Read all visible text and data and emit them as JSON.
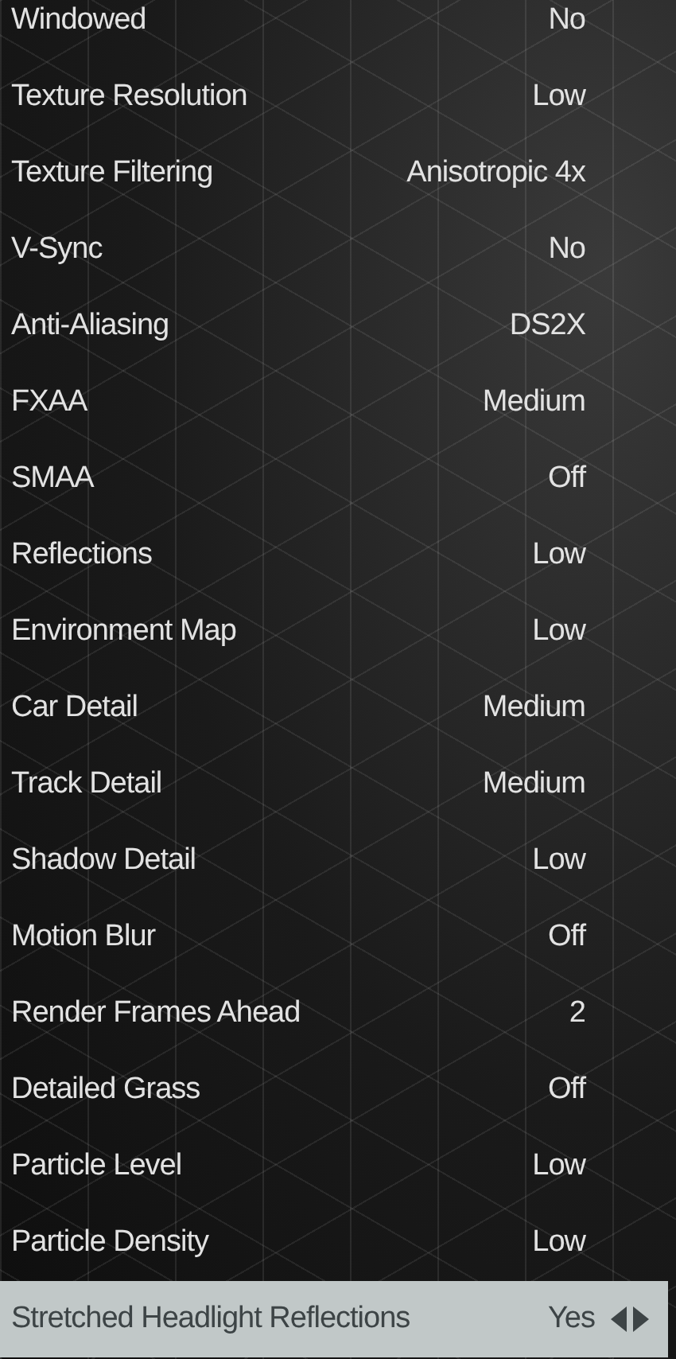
{
  "settings": [
    {
      "label": "Windowed",
      "value": "No",
      "selected": false
    },
    {
      "label": "Texture Resolution",
      "value": "Low",
      "selected": false
    },
    {
      "label": "Texture Filtering",
      "value": "Anisotropic 4x",
      "selected": false
    },
    {
      "label": "V-Sync",
      "value": "No",
      "selected": false
    },
    {
      "label": "Anti-Aliasing",
      "value": "DS2X",
      "selected": false
    },
    {
      "label": "FXAA",
      "value": "Medium",
      "selected": false
    },
    {
      "label": "SMAA",
      "value": "Off",
      "selected": false
    },
    {
      "label": "Reflections",
      "value": "Low",
      "selected": false
    },
    {
      "label": "Environment Map",
      "value": "Low",
      "selected": false
    },
    {
      "label": "Car Detail",
      "value": "Medium",
      "selected": false
    },
    {
      "label": "Track Detail",
      "value": "Medium",
      "selected": false
    },
    {
      "label": "Shadow Detail",
      "value": "Low",
      "selected": false
    },
    {
      "label": "Motion Blur",
      "value": "Off",
      "selected": false
    },
    {
      "label": "Render Frames Ahead",
      "value": "2",
      "selected": false
    },
    {
      "label": "Detailed Grass",
      "value": "Off",
      "selected": false
    },
    {
      "label": "Particle Level",
      "value": "Low",
      "selected": false
    },
    {
      "label": "Particle Density",
      "value": "Low",
      "selected": false
    },
    {
      "label": "Stretched Headlight Reflections",
      "value": "Yes",
      "selected": true
    }
  ]
}
